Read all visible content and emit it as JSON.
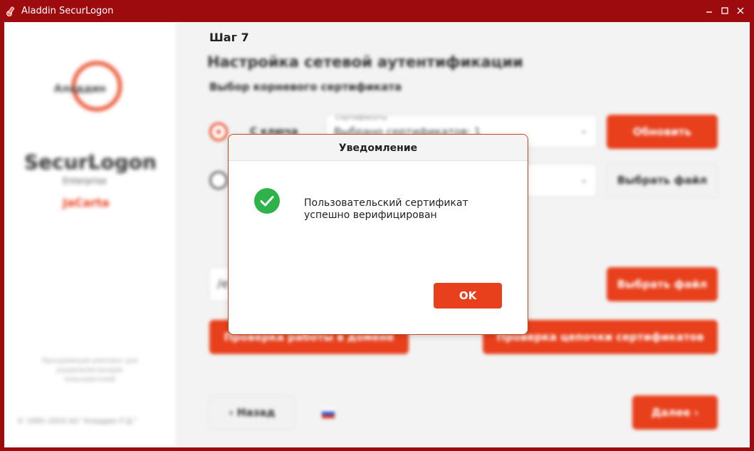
{
  "window": {
    "title": "Aladdin SecurLogon",
    "minimize_label": "–",
    "close_label": "✕"
  },
  "sidebar": {
    "logo_text": "Аладдин",
    "brand": "SecurLogon",
    "edition": "Enterprise",
    "token": "JaCarta",
    "note": "Программный комплекс для управления входом пользователей",
    "copyright": "© 1995–2024 АО \"Аладдин Р.Д.\""
  },
  "main": {
    "step": "Шаг 7",
    "heading": "Настройка сетевой аутентификации",
    "subheading": "Выбор корневого сертификата",
    "option_key": "С ключа",
    "cert_field_label": "Сертификаты",
    "cert_field_value": "Выбрано сертификатов: 1",
    "refresh_button": "Обновить",
    "choose_file_button": "Выбрать файл",
    "path_value": "/e",
    "choose_file_button2": "Выбрать файл",
    "check_domain_button": "Проверка работы в домене",
    "check_chain_button": "Проверка цепочки сертификатов",
    "back_button": "Назад",
    "next_button": "Далее"
  },
  "dialog": {
    "title": "Уведомление",
    "message_line1": "Пользовательский сертификат",
    "message_line2": "успешно верифицирован",
    "ok_button": "OK"
  },
  "colors": {
    "accent": "#e8401c",
    "titlebar": "#9e0b0f",
    "success": "#2db34a"
  },
  "icons": {
    "app": "aladdin-key-icon",
    "success": "check-circle-icon",
    "back": "chevron-left-icon",
    "next": "chevron-right-icon",
    "language": "russian-flag-icon"
  }
}
